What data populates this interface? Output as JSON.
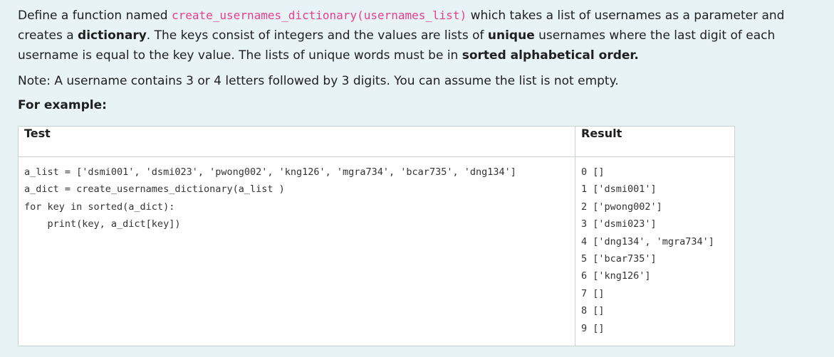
{
  "question": {
    "p1": {
      "t1": "Define a function named ",
      "code": "create_usernames_dictionary(usernames_list)",
      "t2": " which takes a list of usernames as a parameter and creates a ",
      "b1": "dictionary",
      "t3": ". The keys consist of integers and the values are lists of ",
      "b2": "unique",
      "t4": " usernames where the last digit of each username is equal to the key value. The lists of unique words must be in ",
      "b3": "sorted alphabetical order."
    },
    "note": "Note: A username contains 3 or 4 letters followed by 3 digits. You can assume the list is not empty.",
    "example_heading": "For example:"
  },
  "table": {
    "header_test": "Test",
    "header_result": "Result",
    "test_lines": [
      "a_list = ['dsmi001', 'dsmi023', 'pwong002', 'kng126', 'mgra734', 'bcar735', 'dng134']",
      "a_dict = create_usernames_dictionary(a_list )",
      "for key in sorted(a_dict):",
      "    print(key, a_dict[key])"
    ],
    "result_lines": [
      "0 []",
      "1 ['dsmi001']",
      "2 ['pwong002']",
      "3 ['dsmi023']",
      "4 ['dng134', 'mgra734']",
      "5 ['bcar735']",
      "6 ['kng126']",
      "7 []",
      "8 []",
      "9 []"
    ]
  }
}
